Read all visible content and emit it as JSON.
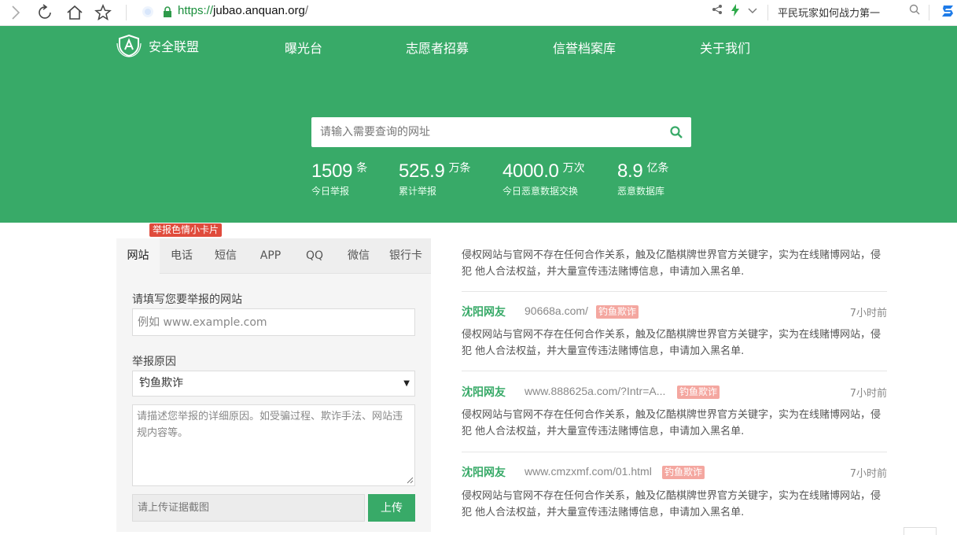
{
  "browser": {
    "url_scheme": "https://",
    "url_host": "jubao.anquan.org",
    "url_path": "/",
    "search_text": "平民玩家如何战力第一",
    "icons": [
      "back-icon",
      "reload-icon",
      "home-icon",
      "star-icon",
      "share-icon",
      "lightning-icon",
      "chevron-down-icon",
      "search-icon",
      "browser-logo-icon"
    ]
  },
  "header": {
    "logo_text": "安全联盟",
    "nav": [
      "曝光台",
      "志愿者招募",
      "信誉档案库",
      "关于我们"
    ]
  },
  "search": {
    "placeholder": "请输入需要查询的网址"
  },
  "stats": [
    {
      "value": "1509",
      "unit": "条",
      "label": "今日举报"
    },
    {
      "value": "525.9",
      "unit": "万条",
      "label": "累计举报"
    },
    {
      "value": "4000.0",
      "unit": "万次",
      "label": "今日恶意数据交换"
    },
    {
      "value": "8.9",
      "unit": "亿条",
      "label": "恶意数据库"
    }
  ],
  "form": {
    "promo_badge": "举报色情小卡片",
    "tabs": [
      "网站",
      "电话",
      "短信",
      "APP",
      "QQ",
      "微信",
      "银行卡"
    ],
    "active_tab": "网站",
    "site_label": "请填写您要举报的网站",
    "site_placeholder": "例如 www.example.com",
    "reason_label": "举报原因",
    "reason_selected": "钓鱼欺诈",
    "desc_placeholder": "请描述您举报的详细原因。如受骗过程、欺诈手法、网站违规内容等。",
    "upload_placeholder": "请上传证据截图",
    "upload_label": "上传"
  },
  "reports": {
    "first_desc": "侵权网站与官网不存在任何合作关系，触及亿酷棋牌世界官方关键字，实为在线赌博网站，侵犯 他人合法权益，并大量宣传违法赌博信息，申请加入黑名单.",
    "items": [
      {
        "user": "沈阳网友",
        "site": "90668a.com/",
        "tag": "钓鱼欺诈",
        "time": "7小时前",
        "desc": "侵权网站与官网不存在任何合作关系，触及亿酷棋牌世界官方关键字，实为在线赌博网站，侵犯 他人合法权益，并大量宣传违法赌博信息，申请加入黑名单."
      },
      {
        "user": "沈阳网友",
        "site": "www.888625a.com/?Intr=A...",
        "tag": "钓鱼欺诈",
        "time": "7小时前",
        "desc": "侵权网站与官网不存在任何合作关系，触及亿酷棋牌世界官方关键字，实为在线赌博网站，侵犯 他人合法权益，并大量宣传违法赌博信息，申请加入黑名单."
      },
      {
        "user": "沈阳网友",
        "site": "www.cmzxmf.com/01.html",
        "tag": "钓鱼欺诈",
        "time": "7小时前",
        "desc": "侵权网站与官网不存在任何合作关系，触及亿酷棋牌世界官方关键字，实为在线赌博网站，侵犯 他人合法权益，并大量宣传违法赌博信息，申请加入黑名单."
      }
    ]
  }
}
